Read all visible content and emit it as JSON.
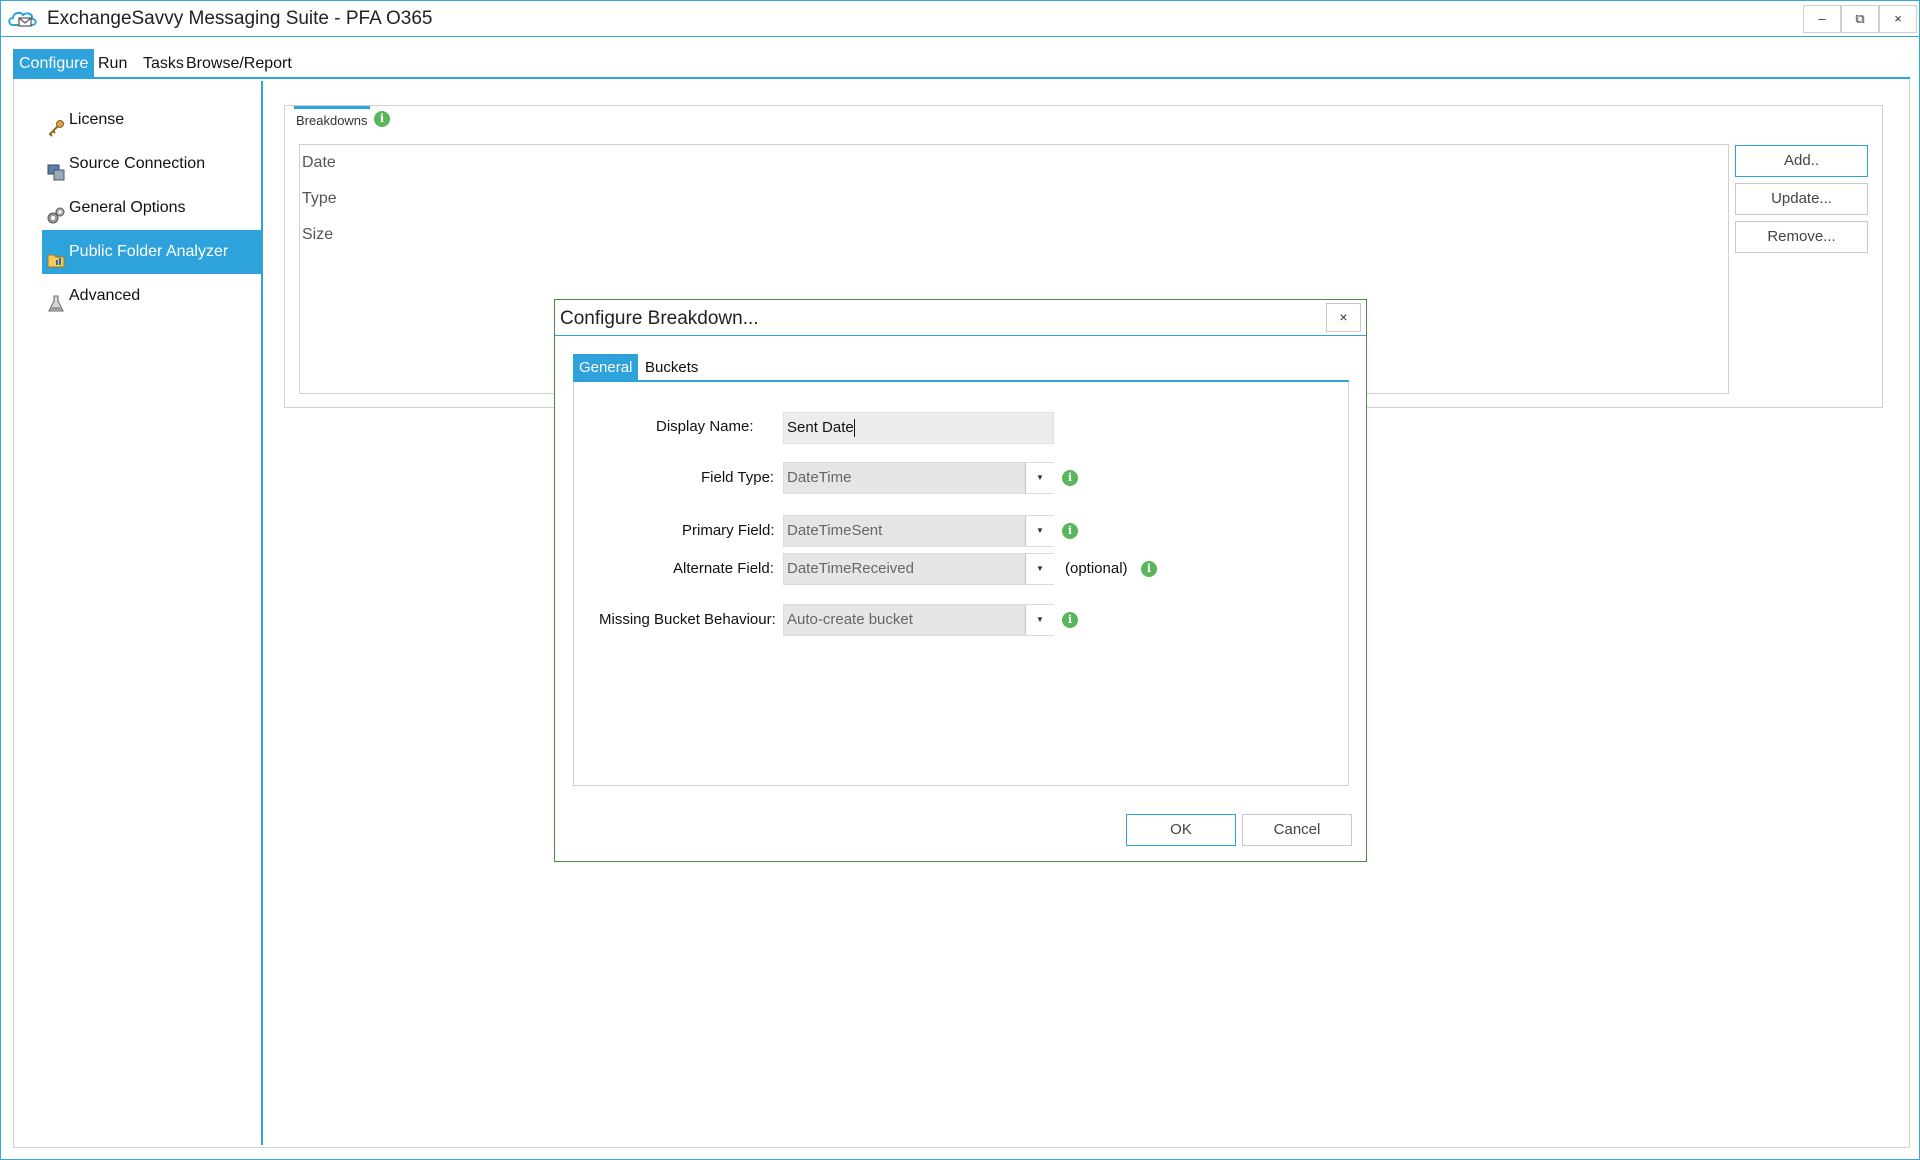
{
  "window": {
    "title": "ExchangeSavvy Messaging Suite - PFA O365",
    "app_icon": "cloud-envelope-icon",
    "controls": {
      "minimize": "–",
      "restore": "⧉",
      "close": "×"
    }
  },
  "menubar": {
    "items": [
      {
        "label": "Configure",
        "active": true
      },
      {
        "label": "Run",
        "active": false
      },
      {
        "label": "Tasks",
        "active": false
      },
      {
        "label": "Browse/Report",
        "active": false
      }
    ]
  },
  "sidebar": {
    "items": [
      {
        "label": "License",
        "icon": "key-icon",
        "active": false
      },
      {
        "label": "Source Connection",
        "icon": "server-connection-icon",
        "active": false
      },
      {
        "label": "General Options",
        "icon": "gears-icon",
        "active": false
      },
      {
        "label": "Public Folder Analyzer",
        "icon": "folder-chart-icon",
        "active": true
      },
      {
        "label": "Advanced",
        "icon": "advanced-flask-icon",
        "active": false
      }
    ]
  },
  "breakdowns": {
    "tab_label": "Breakdowns",
    "items": [
      "Date",
      "Type",
      "Size"
    ],
    "buttons": {
      "add": "Add..",
      "update": "Update...",
      "remove": "Remove..."
    }
  },
  "dialog": {
    "title": "Configure Breakdown...",
    "close": "×",
    "tabs": [
      {
        "label": "General",
        "active": true
      },
      {
        "label": "Buckets",
        "active": false
      }
    ],
    "fields": {
      "display_name": {
        "label": "Display Name:",
        "value": "Sent Date"
      },
      "field_type": {
        "label": "Field Type:",
        "value": "DateTime"
      },
      "primary_field": {
        "label": "Primary Field:",
        "value": "DateTimeSent"
      },
      "alternate_field": {
        "label": "Alternate Field:",
        "value": "DateTimeReceived",
        "note": "(optional)"
      },
      "missing_bucket": {
        "label": "Missing Bucket Behaviour:",
        "value": "Auto-create bucket"
      }
    },
    "combo_arrow": "▼",
    "info_glyph": "i",
    "buttons": {
      "ok": "OK",
      "cancel": "Cancel"
    }
  },
  "colors": {
    "accent": "#2ea2da",
    "info_green": "#5ab65a",
    "dialog_border": "#4a8c3f"
  }
}
